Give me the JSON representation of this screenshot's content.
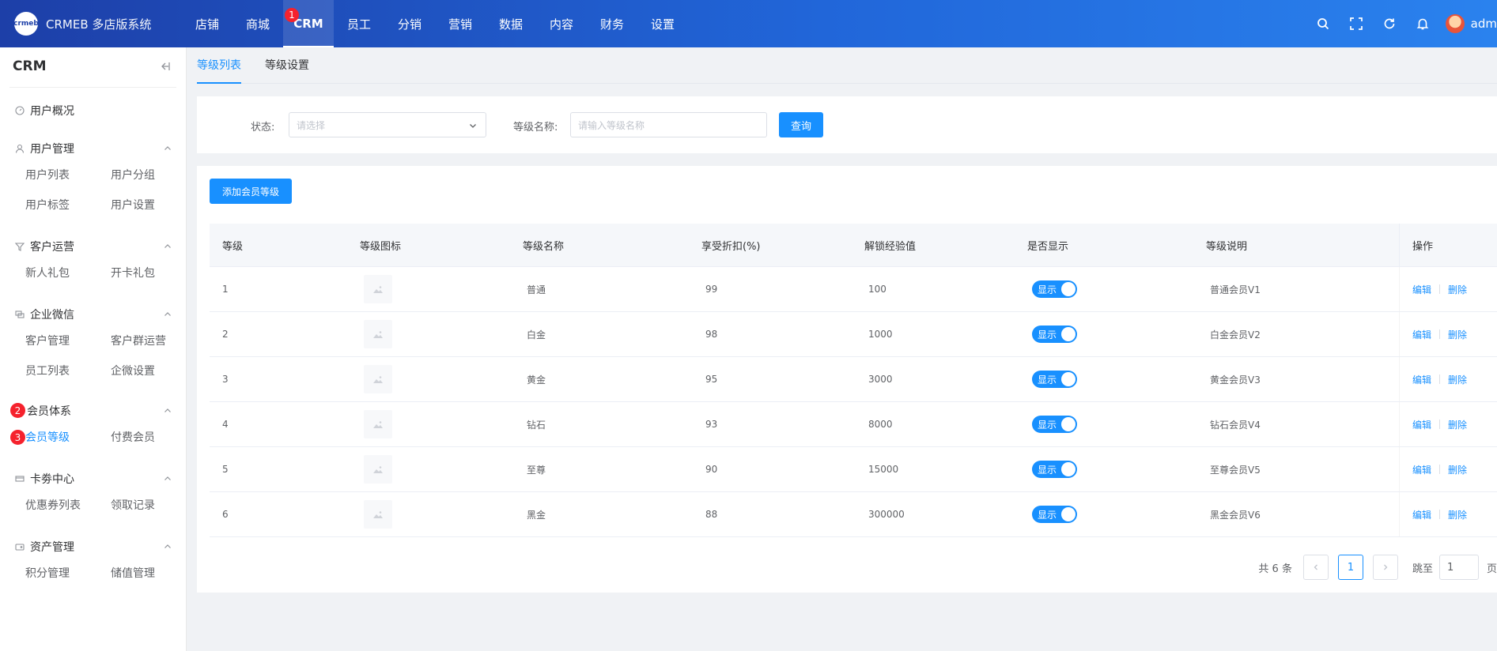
{
  "header": {
    "logo_mark": "crmeb",
    "brand": "CRMEB 多店版系统",
    "nav": [
      {
        "label": "店铺"
      },
      {
        "label": "商城"
      },
      {
        "label": "CRM",
        "badge": "1"
      },
      {
        "label": "员工"
      },
      {
        "label": "分销"
      },
      {
        "label": "营销"
      },
      {
        "label": "数据"
      },
      {
        "label": "内容"
      },
      {
        "label": "财务"
      },
      {
        "label": "设置"
      }
    ],
    "username": "adm",
    "icons": [
      "search-icon",
      "fullscreen-icon",
      "refresh-icon",
      "bell-icon"
    ]
  },
  "sidebar": {
    "title": "CRM",
    "sections": [
      {
        "label": "用户概况",
        "icon": "dashboard-icon",
        "items": []
      },
      {
        "label": "用户管理",
        "icon": "user-icon",
        "items": [
          "用户列表",
          "用户分组",
          "用户标签",
          "用户设置"
        ]
      },
      {
        "label": "客户运营",
        "icon": "funnel-icon",
        "items": [
          "新人礼包",
          "开卡礼包"
        ]
      },
      {
        "label": "企业微信",
        "icon": "chat-icon",
        "items": [
          "客户管理",
          "客户群运营",
          "员工列表",
          "企微设置"
        ]
      },
      {
        "label": "会员体系",
        "badge": "2",
        "items": [
          "会员等级",
          "付费会员"
        ],
        "active_badge": "3"
      },
      {
        "label": "卡劵中心",
        "icon": "card-icon",
        "items": [
          "优惠券列表",
          "领取记录"
        ]
      },
      {
        "label": "资产管理",
        "icon": "wallet-icon",
        "items": [
          "积分管理",
          "储值管理"
        ]
      }
    ]
  },
  "tabs": [
    "等级列表",
    "等级设置"
  ],
  "filter": {
    "status_label": "状态:",
    "status_placeholder": "请选择",
    "name_label": "等级名称:",
    "name_placeholder": "请输入等级名称",
    "query_button": "查询"
  },
  "add_button": "添加会员等级",
  "table": {
    "columns": [
      "等级",
      "等级图标",
      "等级名称",
      "享受折扣(%)",
      "解锁经验值",
      "是否显示",
      "等级说明",
      "操作"
    ],
    "rows": [
      {
        "level": "1",
        "name": "普通",
        "discount": "99",
        "exp": "100",
        "show": "显示",
        "desc": "普通会员V1"
      },
      {
        "level": "2",
        "name": "白金",
        "discount": "98",
        "exp": "1000",
        "show": "显示",
        "desc": "白金会员V2"
      },
      {
        "level": "3",
        "name": "黄金",
        "discount": "95",
        "exp": "3000",
        "show": "显示",
        "desc": "黄金会员V3"
      },
      {
        "level": "4",
        "name": "钻石",
        "discount": "93",
        "exp": "8000",
        "show": "显示",
        "desc": "钻石会员V4"
      },
      {
        "level": "5",
        "name": "至尊",
        "discount": "90",
        "exp": "15000",
        "show": "显示",
        "desc": "至尊会员V5"
      },
      {
        "level": "6",
        "name": "黑金",
        "discount": "88",
        "exp": "300000",
        "show": "显示",
        "desc": "黑金会员V6"
      }
    ],
    "edit_label": "编辑",
    "delete_label": "删除"
  },
  "pager": {
    "total": "共 6 条",
    "current": "1",
    "jump_label": "跳至",
    "jump_value": "1",
    "page_unit": "页"
  },
  "colors": {
    "primary": "#1890ff",
    "badge": "#f5222d"
  }
}
